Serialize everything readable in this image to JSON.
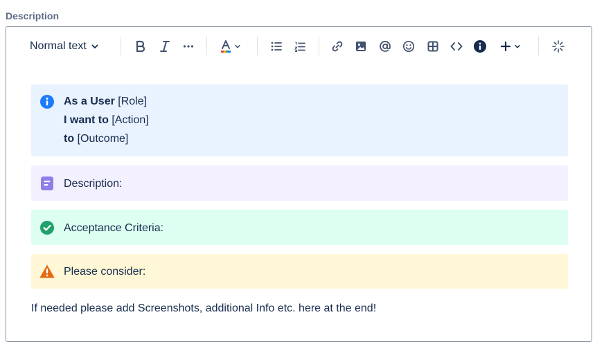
{
  "field": {
    "label": "Description"
  },
  "toolbar": {
    "text_style": "Normal text",
    "icons": {
      "chevron": "chevron-down-icon",
      "bold": "bold-icon",
      "italic": "italic-icon",
      "more": "more-formatting-icon",
      "text_color": "text-color-icon",
      "bullet_list": "bullet-list-icon",
      "numbered_list": "numbered-list-icon",
      "link": "link-icon",
      "image": "image-icon",
      "mention": "mention-icon",
      "emoji": "emoji-icon",
      "table": "table-icon",
      "code": "code-icon",
      "info": "info-icon",
      "insert": "insert-plus-icon",
      "ai": "ai-sparkle-icon"
    }
  },
  "content": {
    "info_panel": {
      "line1_bold": "As a User",
      "line1_rest": "[Role]",
      "line2_bold": "I want to",
      "line2_rest": "[Action]",
      "line3_bold": "to",
      "line3_rest": "[Outcome]"
    },
    "note_panel": {
      "text": "Description:"
    },
    "success_panel": {
      "text": "Acceptance Criteria:"
    },
    "warning_panel": {
      "text": "Please consider:"
    },
    "footer": "If needed please add Screenshots, additional Info etc. here at the end!"
  },
  "colors": {
    "info_bg": "#E9F2FF",
    "note_bg": "#F3F0FF",
    "success_bg": "#DCFFF1",
    "warning_bg": "#FFF7D6",
    "info_icon": "#1D7AFC",
    "note_icon": "#8F7EE7",
    "success_icon": "#22A06B",
    "warning_icon": "#E56910"
  }
}
